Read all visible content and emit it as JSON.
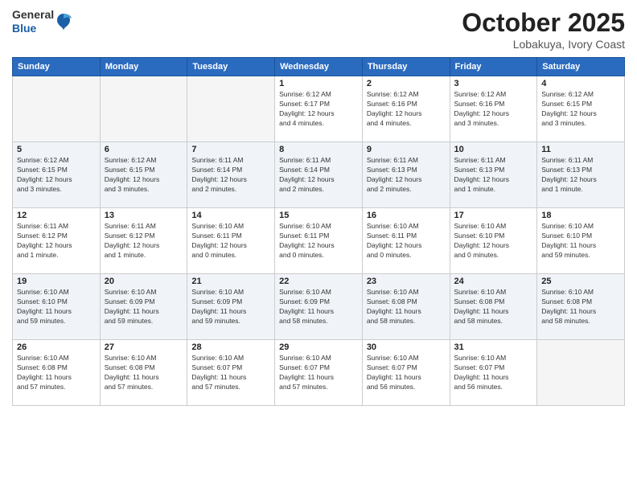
{
  "header": {
    "logo": {
      "general": "General",
      "blue": "Blue"
    },
    "title": "October 2025",
    "location": "Lobakuya, Ivory Coast"
  },
  "weekdays": [
    "Sunday",
    "Monday",
    "Tuesday",
    "Wednesday",
    "Thursday",
    "Friday",
    "Saturday"
  ],
  "weeks": [
    {
      "alt": false,
      "days": [
        {
          "num": "",
          "info": ""
        },
        {
          "num": "",
          "info": ""
        },
        {
          "num": "",
          "info": ""
        },
        {
          "num": "1",
          "info": "Sunrise: 6:12 AM\nSunset: 6:17 PM\nDaylight: 12 hours\nand 4 minutes."
        },
        {
          "num": "2",
          "info": "Sunrise: 6:12 AM\nSunset: 6:16 PM\nDaylight: 12 hours\nand 4 minutes."
        },
        {
          "num": "3",
          "info": "Sunrise: 6:12 AM\nSunset: 6:16 PM\nDaylight: 12 hours\nand 3 minutes."
        },
        {
          "num": "4",
          "info": "Sunrise: 6:12 AM\nSunset: 6:15 PM\nDaylight: 12 hours\nand 3 minutes."
        }
      ]
    },
    {
      "alt": true,
      "days": [
        {
          "num": "5",
          "info": "Sunrise: 6:12 AM\nSunset: 6:15 PM\nDaylight: 12 hours\nand 3 minutes."
        },
        {
          "num": "6",
          "info": "Sunrise: 6:12 AM\nSunset: 6:15 PM\nDaylight: 12 hours\nand 3 minutes."
        },
        {
          "num": "7",
          "info": "Sunrise: 6:11 AM\nSunset: 6:14 PM\nDaylight: 12 hours\nand 2 minutes."
        },
        {
          "num": "8",
          "info": "Sunrise: 6:11 AM\nSunset: 6:14 PM\nDaylight: 12 hours\nand 2 minutes."
        },
        {
          "num": "9",
          "info": "Sunrise: 6:11 AM\nSunset: 6:13 PM\nDaylight: 12 hours\nand 2 minutes."
        },
        {
          "num": "10",
          "info": "Sunrise: 6:11 AM\nSunset: 6:13 PM\nDaylight: 12 hours\nand 1 minute."
        },
        {
          "num": "11",
          "info": "Sunrise: 6:11 AM\nSunset: 6:13 PM\nDaylight: 12 hours\nand 1 minute."
        }
      ]
    },
    {
      "alt": false,
      "days": [
        {
          "num": "12",
          "info": "Sunrise: 6:11 AM\nSunset: 6:12 PM\nDaylight: 12 hours\nand 1 minute."
        },
        {
          "num": "13",
          "info": "Sunrise: 6:11 AM\nSunset: 6:12 PM\nDaylight: 12 hours\nand 1 minute."
        },
        {
          "num": "14",
          "info": "Sunrise: 6:10 AM\nSunset: 6:11 PM\nDaylight: 12 hours\nand 0 minutes."
        },
        {
          "num": "15",
          "info": "Sunrise: 6:10 AM\nSunset: 6:11 PM\nDaylight: 12 hours\nand 0 minutes."
        },
        {
          "num": "16",
          "info": "Sunrise: 6:10 AM\nSunset: 6:11 PM\nDaylight: 12 hours\nand 0 minutes."
        },
        {
          "num": "17",
          "info": "Sunrise: 6:10 AM\nSunset: 6:10 PM\nDaylight: 12 hours\nand 0 minutes."
        },
        {
          "num": "18",
          "info": "Sunrise: 6:10 AM\nSunset: 6:10 PM\nDaylight: 11 hours\nand 59 minutes."
        }
      ]
    },
    {
      "alt": true,
      "days": [
        {
          "num": "19",
          "info": "Sunrise: 6:10 AM\nSunset: 6:10 PM\nDaylight: 11 hours\nand 59 minutes."
        },
        {
          "num": "20",
          "info": "Sunrise: 6:10 AM\nSunset: 6:09 PM\nDaylight: 11 hours\nand 59 minutes."
        },
        {
          "num": "21",
          "info": "Sunrise: 6:10 AM\nSunset: 6:09 PM\nDaylight: 11 hours\nand 59 minutes."
        },
        {
          "num": "22",
          "info": "Sunrise: 6:10 AM\nSunset: 6:09 PM\nDaylight: 11 hours\nand 58 minutes."
        },
        {
          "num": "23",
          "info": "Sunrise: 6:10 AM\nSunset: 6:08 PM\nDaylight: 11 hours\nand 58 minutes."
        },
        {
          "num": "24",
          "info": "Sunrise: 6:10 AM\nSunset: 6:08 PM\nDaylight: 11 hours\nand 58 minutes."
        },
        {
          "num": "25",
          "info": "Sunrise: 6:10 AM\nSunset: 6:08 PM\nDaylight: 11 hours\nand 58 minutes."
        }
      ]
    },
    {
      "alt": false,
      "days": [
        {
          "num": "26",
          "info": "Sunrise: 6:10 AM\nSunset: 6:08 PM\nDaylight: 11 hours\nand 57 minutes."
        },
        {
          "num": "27",
          "info": "Sunrise: 6:10 AM\nSunset: 6:08 PM\nDaylight: 11 hours\nand 57 minutes."
        },
        {
          "num": "28",
          "info": "Sunrise: 6:10 AM\nSunset: 6:07 PM\nDaylight: 11 hours\nand 57 minutes."
        },
        {
          "num": "29",
          "info": "Sunrise: 6:10 AM\nSunset: 6:07 PM\nDaylight: 11 hours\nand 57 minutes."
        },
        {
          "num": "30",
          "info": "Sunrise: 6:10 AM\nSunset: 6:07 PM\nDaylight: 11 hours\nand 56 minutes."
        },
        {
          "num": "31",
          "info": "Sunrise: 6:10 AM\nSunset: 6:07 PM\nDaylight: 11 hours\nand 56 minutes."
        },
        {
          "num": "",
          "info": ""
        }
      ]
    }
  ]
}
